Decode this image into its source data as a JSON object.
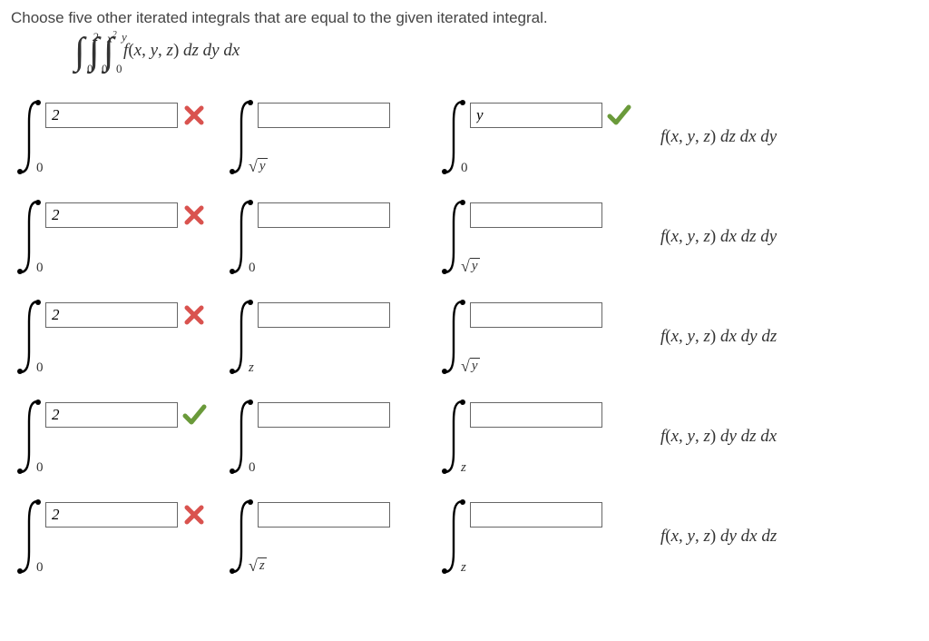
{
  "prompt": "Choose five other iterated integrals that are equal to the given iterated integral.",
  "given": {
    "limits": [
      {
        "lower": "0",
        "upper": "2"
      },
      {
        "lower": "0",
        "upper": "x²"
      },
      {
        "lower": "0",
        "upper": "y"
      }
    ],
    "integrand": "f(x, y, z) dz dy dx"
  },
  "rows": [
    {
      "cells": [
        {
          "lower": "0",
          "box": "2",
          "mark": "wrong"
        },
        {
          "lower": "√y",
          "box": ""
        },
        {
          "lower": "0",
          "box": "y",
          "mark": "correct"
        }
      ],
      "integrand": "f(x, y, z) dz dx dy"
    },
    {
      "cells": [
        {
          "lower": "0",
          "box": "2",
          "mark": "wrong"
        },
        {
          "lower": "0",
          "box": ""
        },
        {
          "lower": "√y",
          "box": ""
        }
      ],
      "integrand": "f(x, y, z) dx dz dy"
    },
    {
      "cells": [
        {
          "lower": "0",
          "box": "2",
          "mark": "wrong"
        },
        {
          "lower": "z",
          "box": ""
        },
        {
          "lower": "√y",
          "box": ""
        }
      ],
      "integrand": "f(x, y, z) dx dy dz"
    },
    {
      "cells": [
        {
          "lower": "0",
          "box": "2",
          "mark": "correct"
        },
        {
          "lower": "0",
          "box": ""
        },
        {
          "lower": "z",
          "box": ""
        }
      ],
      "integrand": "f(x, y, z) dy dz dx"
    },
    {
      "cells": [
        {
          "lower": "0",
          "box": "2",
          "mark": "wrong"
        },
        {
          "lower": "√z",
          "box": ""
        },
        {
          "lower": "z",
          "box": ""
        }
      ],
      "integrand": "f(x, y, z) dy dx dz"
    }
  ]
}
